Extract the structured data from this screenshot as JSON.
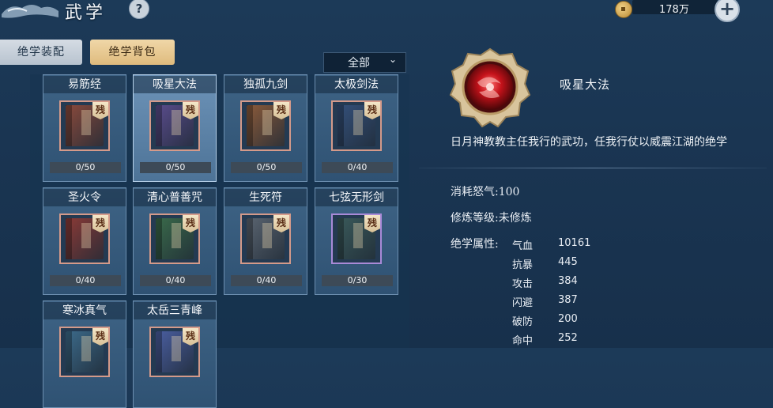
{
  "header": {
    "title": "武学",
    "help_label": "?",
    "currency_value": "178万",
    "plus_label": "+"
  },
  "tabs": [
    {
      "label": "绝学装配"
    },
    {
      "label": "绝学背包"
    }
  ],
  "filter": {
    "selected": "全部",
    "caret": "⌄"
  },
  "cards": [
    {
      "name": "易筋经",
      "progress": "0/50",
      "color": "#8a4a3c"
    },
    {
      "name": "吸星大法",
      "progress": "0/50",
      "color": "#5a4c8c",
      "selected": true
    },
    {
      "name": "独孤九剑",
      "progress": "0/50",
      "color": "#8a5a3a"
    },
    {
      "name": "太极剑法",
      "progress": "0/40",
      "color": "#34507a"
    },
    {
      "name": "圣火令",
      "progress": "0/40",
      "color": "#8a3a36"
    },
    {
      "name": "清心普善咒",
      "progress": "0/40",
      "color": "#3a6a4a"
    },
    {
      "name": "生死符",
      "progress": "0/40",
      "color": "#5a6470"
    },
    {
      "name": "七弦无形剑",
      "progress": "0/30",
      "color": "#3a5a5a"
    },
    {
      "name": "寒冰真气",
      "progress": "",
      "color": "#3c6a8a"
    },
    {
      "name": "太岳三青峰",
      "progress": "",
      "color": "#4a5ea0"
    }
  ],
  "frag_label": "残",
  "detail": {
    "name": "吸星大法",
    "description": "日月神教教主任我行的武功，任我行仗以威震江湖的绝学",
    "cost_line": "消耗怒气:100",
    "level_line": "修炼等级:未修炼",
    "attr_title": "绝学属性:",
    "attributes": [
      {
        "label": "气血",
        "value": "10161"
      },
      {
        "label": "抗暴",
        "value": "445"
      },
      {
        "label": "攻击",
        "value": "384"
      },
      {
        "label": "闪避",
        "value": "387"
      },
      {
        "label": "破防",
        "value": "200"
      },
      {
        "label": "命中",
        "value": "252"
      }
    ]
  }
}
